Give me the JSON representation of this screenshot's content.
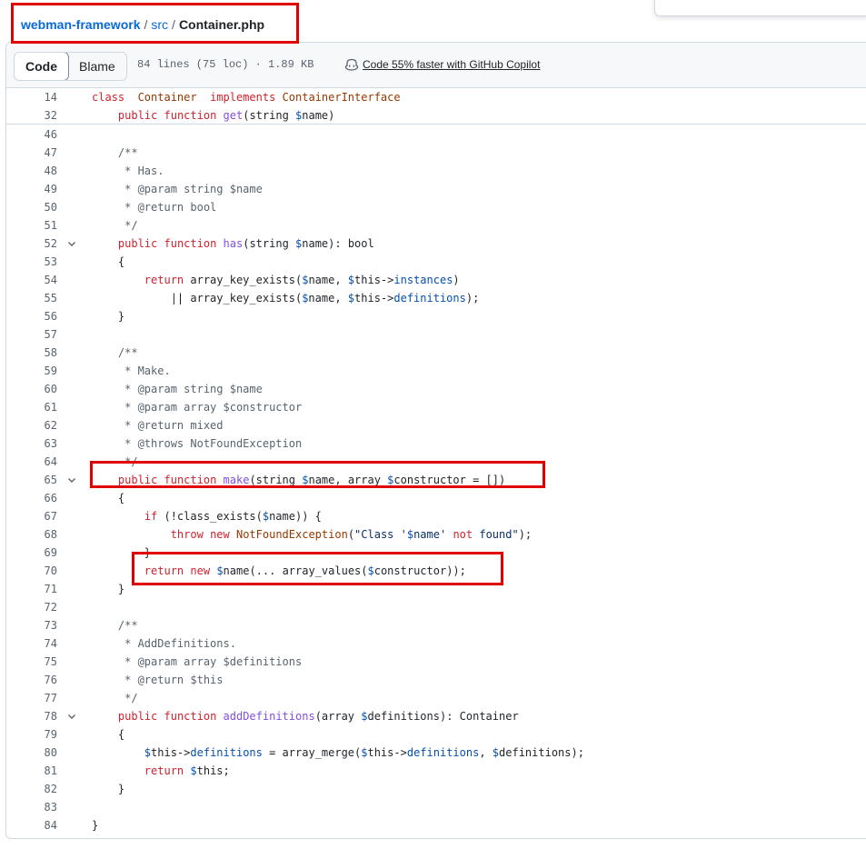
{
  "breadcrumb": {
    "repo": "webman-framework",
    "separator": "/",
    "folder": "src",
    "file": "Container.php"
  },
  "toolbar": {
    "code_label": "Code",
    "blame_label": "Blame",
    "file_info": "84 lines (75 loc) · 1.89 KB",
    "copilot_text": "Code 55% faster with GitHub Copilot"
  },
  "icons": {
    "copilot": "copilot-icon",
    "fold": "chevron-down-icon"
  },
  "colors": {
    "keyword": "#cf222e",
    "function": "#8250df",
    "class": "#953800",
    "variable": "#0550ae",
    "comment": "#59636e",
    "string": "#0a3069",
    "link": "#0969da",
    "highlight": "#e00000"
  },
  "sticky_lines": [
    {
      "n": "14",
      "tokens": [
        [
          "k",
          "class"
        ],
        [
          "",
          "  "
        ],
        [
          "e",
          "Container"
        ],
        [
          "",
          "  "
        ],
        [
          "k",
          "implements"
        ],
        [
          "",
          " "
        ],
        [
          "e",
          "ContainerInterface"
        ]
      ]
    },
    {
      "n": "32",
      "tokens": [
        [
          "",
          "    "
        ],
        [
          "k",
          "public"
        ],
        [
          "",
          " "
        ],
        [
          "k",
          "function"
        ],
        [
          "",
          " "
        ],
        [
          "f",
          "get"
        ],
        [
          "",
          "(string "
        ],
        [
          "v",
          "$"
        ],
        [
          "",
          "name)"
        ]
      ]
    }
  ],
  "lines": [
    {
      "n": "46",
      "tokens": []
    },
    {
      "n": "47",
      "tokens": [
        [
          "c",
          "    /**"
        ]
      ]
    },
    {
      "n": "48",
      "tokens": [
        [
          "c",
          "     * Has."
        ]
      ]
    },
    {
      "n": "49",
      "tokens": [
        [
          "c",
          "     * @param string $name"
        ]
      ]
    },
    {
      "n": "50",
      "tokens": [
        [
          "c",
          "     * @return bool"
        ]
      ]
    },
    {
      "n": "51",
      "tokens": [
        [
          "c",
          "     */"
        ]
      ]
    },
    {
      "n": "52",
      "fold": true,
      "tokens": [
        [
          "",
          "    "
        ],
        [
          "k",
          "public"
        ],
        [
          "",
          " "
        ],
        [
          "k",
          "function"
        ],
        [
          "",
          " "
        ],
        [
          "f",
          "has"
        ],
        [
          "",
          "(string "
        ],
        [
          "v",
          "$"
        ],
        [
          "",
          "name): bool"
        ]
      ]
    },
    {
      "n": "53",
      "tokens": [
        [
          "",
          "    {"
        ]
      ]
    },
    {
      "n": "54",
      "tokens": [
        [
          "",
          "        "
        ],
        [
          "k",
          "return"
        ],
        [
          "",
          " array_key_exists("
        ],
        [
          "v",
          "$"
        ],
        [
          "",
          "name, "
        ],
        [
          "v",
          "$"
        ],
        [
          "",
          "this->"
        ],
        [
          "v",
          "instances"
        ],
        [
          "",
          ")"
        ]
      ]
    },
    {
      "n": "55",
      "tokens": [
        [
          "",
          "            || array_key_exists("
        ],
        [
          "v",
          "$"
        ],
        [
          "",
          "name, "
        ],
        [
          "v",
          "$"
        ],
        [
          "",
          "this->"
        ],
        [
          "v",
          "definitions"
        ],
        [
          "",
          ");"
        ]
      ]
    },
    {
      "n": "56",
      "tokens": [
        [
          "",
          "    }"
        ]
      ]
    },
    {
      "n": "57",
      "tokens": []
    },
    {
      "n": "58",
      "tokens": [
        [
          "c",
          "    /**"
        ]
      ]
    },
    {
      "n": "59",
      "tokens": [
        [
          "c",
          "     * Make."
        ]
      ]
    },
    {
      "n": "60",
      "tokens": [
        [
          "c",
          "     * @param string $name"
        ]
      ]
    },
    {
      "n": "61",
      "tokens": [
        [
          "c",
          "     * @param array $constructor"
        ]
      ]
    },
    {
      "n": "62",
      "tokens": [
        [
          "c",
          "     * @return mixed"
        ]
      ]
    },
    {
      "n": "63",
      "tokens": [
        [
          "c",
          "     * @throws NotFoundException"
        ]
      ]
    },
    {
      "n": "64",
      "tokens": [
        [
          "c",
          "     */"
        ]
      ]
    },
    {
      "n": "65",
      "fold": true,
      "tokens": [
        [
          "",
          "    "
        ],
        [
          "k",
          "public"
        ],
        [
          "",
          " "
        ],
        [
          "k",
          "function"
        ],
        [
          "",
          " "
        ],
        [
          "f",
          "make"
        ],
        [
          "",
          "(string "
        ],
        [
          "v",
          "$"
        ],
        [
          "",
          "name, array "
        ],
        [
          "v",
          "$"
        ],
        [
          "",
          "constructor = [])"
        ]
      ]
    },
    {
      "n": "66",
      "tokens": [
        [
          "",
          "    {"
        ]
      ]
    },
    {
      "n": "67",
      "tokens": [
        [
          "",
          "        "
        ],
        [
          "k",
          "if"
        ],
        [
          "",
          " (!class_exists("
        ],
        [
          "v",
          "$"
        ],
        [
          "",
          "name)) {"
        ]
      ]
    },
    {
      "n": "68",
      "tokens": [
        [
          "",
          "            "
        ],
        [
          "k",
          "throw"
        ],
        [
          "",
          " "
        ],
        [
          "k",
          "new"
        ],
        [
          "",
          " "
        ],
        [
          "e",
          "NotFoundException"
        ],
        [
          "",
          "("
        ],
        [
          "s",
          "\"Class '"
        ],
        [
          "v",
          "$"
        ],
        [
          "s",
          "name' "
        ],
        [
          "k",
          "not"
        ],
        [
          "s",
          " found\""
        ],
        [
          "",
          ");"
        ]
      ]
    },
    {
      "n": "69",
      "tokens": [
        [
          "",
          "        }"
        ]
      ]
    },
    {
      "n": "70",
      "tokens": [
        [
          "",
          "        "
        ],
        [
          "k",
          "return"
        ],
        [
          "",
          " "
        ],
        [
          "k",
          "new"
        ],
        [
          "",
          " "
        ],
        [
          "v",
          "$"
        ],
        [
          "",
          "name(... array_values("
        ],
        [
          "v",
          "$"
        ],
        [
          "",
          "constructor));"
        ]
      ]
    },
    {
      "n": "71",
      "tokens": [
        [
          "",
          "    }"
        ]
      ]
    },
    {
      "n": "72",
      "tokens": []
    },
    {
      "n": "73",
      "tokens": [
        [
          "c",
          "    /**"
        ]
      ]
    },
    {
      "n": "74",
      "tokens": [
        [
          "c",
          "     * AddDefinitions."
        ]
      ]
    },
    {
      "n": "75",
      "tokens": [
        [
          "c",
          "     * @param array $definitions"
        ]
      ]
    },
    {
      "n": "76",
      "tokens": [
        [
          "c",
          "     * @return $this"
        ]
      ]
    },
    {
      "n": "77",
      "tokens": [
        [
          "c",
          "     */"
        ]
      ]
    },
    {
      "n": "78",
      "fold": true,
      "tokens": [
        [
          "",
          "    "
        ],
        [
          "k",
          "public"
        ],
        [
          "",
          " "
        ],
        [
          "k",
          "function"
        ],
        [
          "",
          " "
        ],
        [
          "f",
          "addDefinitions"
        ],
        [
          "",
          "(array "
        ],
        [
          "v",
          "$"
        ],
        [
          "",
          "definitions): Container"
        ]
      ]
    },
    {
      "n": "79",
      "tokens": [
        [
          "",
          "    {"
        ]
      ]
    },
    {
      "n": "80",
      "tokens": [
        [
          "",
          "        "
        ],
        [
          "v",
          "$"
        ],
        [
          "",
          "this->"
        ],
        [
          "v",
          "definitions"
        ],
        [
          "",
          " = array_merge("
        ],
        [
          "v",
          "$"
        ],
        [
          "",
          "this->"
        ],
        [
          "v",
          "definitions"
        ],
        [
          "",
          ", "
        ],
        [
          "v",
          "$"
        ],
        [
          "",
          "definitions);"
        ]
      ]
    },
    {
      "n": "81",
      "tokens": [
        [
          "",
          "        "
        ],
        [
          "k",
          "return"
        ],
        [
          "",
          " "
        ],
        [
          "v",
          "$"
        ],
        [
          "",
          "this;"
        ]
      ]
    },
    {
      "n": "82",
      "tokens": [
        [
          "",
          "    }"
        ]
      ]
    },
    {
      "n": "83",
      "tokens": []
    },
    {
      "n": "84",
      "tokens": [
        [
          "",
          "}"
        ]
      ]
    }
  ]
}
